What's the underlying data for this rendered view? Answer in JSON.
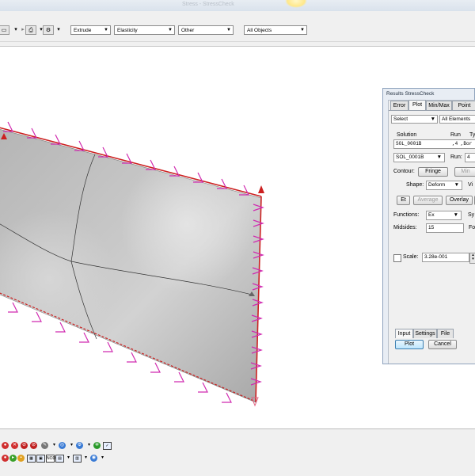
{
  "window": {
    "title": "Stress - StressCheck"
  },
  "toolbar": {
    "extrude": "Extrude",
    "elasticity": "Elasticity",
    "other": "Other",
    "all_objects": "All Objects"
  },
  "results_panel": {
    "title": "Results StressCheck",
    "tabs": [
      "Error",
      "Plot",
      "Min/Max",
      "Point"
    ],
    "select": "Select",
    "all_elements": "All Elements",
    "col_solution": "Solution",
    "col_run": "Run",
    "col_type": "Ty",
    "row_solution": "SOL_0001B",
    "row_run": ",4 ,Bor",
    "solution_dropdown": "SOL_0001B",
    "run_label": "Run:",
    "run_value": "4",
    "contour_label": "Contour:",
    "fringe_button": "Fringe",
    "min_button": "Min",
    "shape_label": "Shape:",
    "shape_value": "Deform",
    "view_label": "Vi",
    "et_button": "Et",
    "average_button": "Average",
    "overlay_button": "Overlay",
    "functions_label": "Functions:",
    "functions_value": "Ex",
    "sy_label": "Sy",
    "midsides_label": "Midsides:",
    "midsides_value": "15",
    "fo_label": "Fo",
    "scale_label": "Scale:",
    "scale_value": "3.28e-001",
    "bottom_tabs": [
      "Input",
      "Settings",
      "File"
    ],
    "plot_button": "Plot",
    "cancel_button": "Cancel"
  }
}
